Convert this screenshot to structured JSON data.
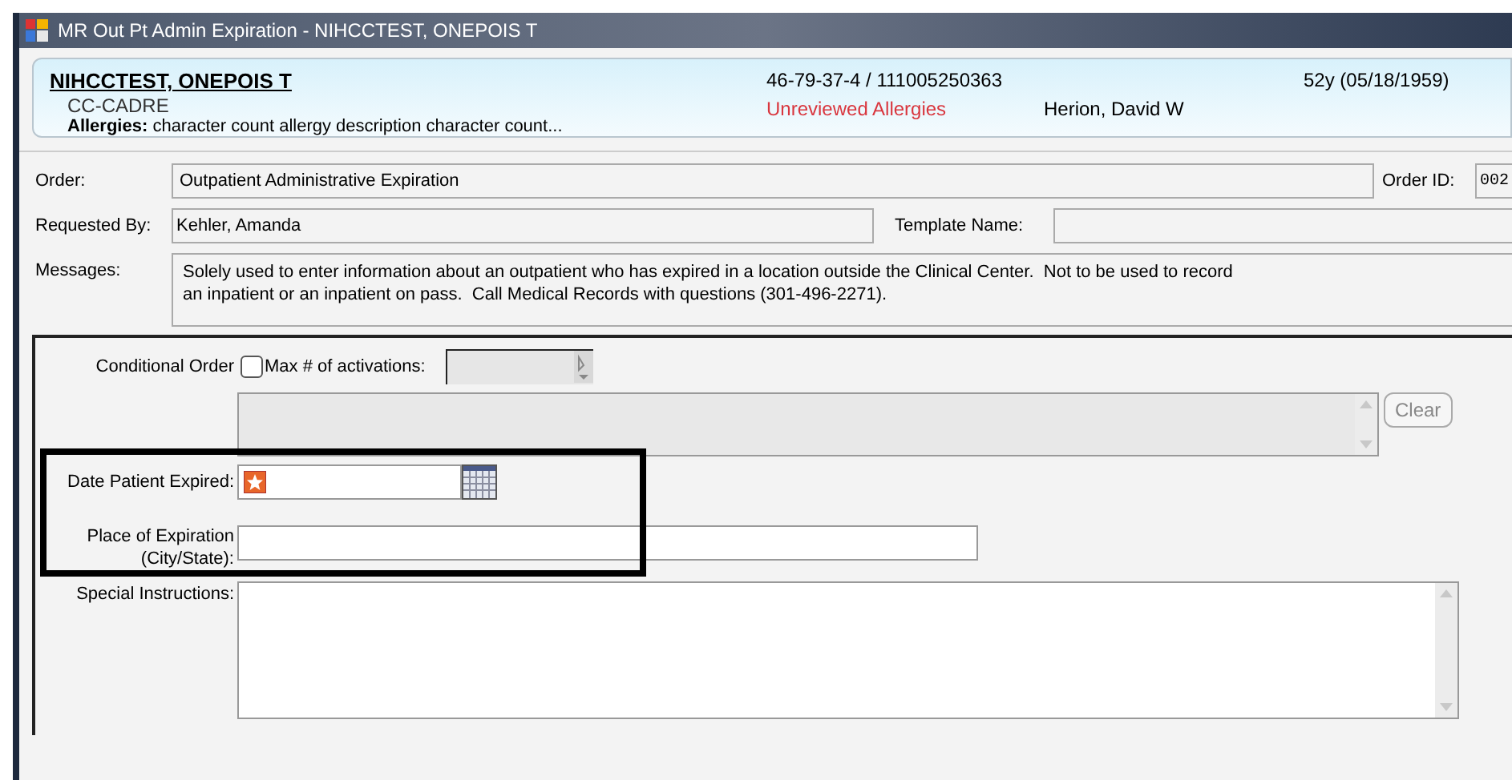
{
  "window": {
    "title": "MR Out Pt Admin Expiration - NIHCCTEST, ONEPOIS T"
  },
  "patient": {
    "name": "NIHCCTEST, ONEPOIS T",
    "location": "CC-CADRE",
    "allergies_label": "Allergies:",
    "allergies": "character count allergy description character count...",
    "ids": "46-79-37-4 / 111005250363",
    "alert": "Unreviewed Allergies",
    "physician": "Herion, David W",
    "age": "52y (05/18/1959)"
  },
  "order": {
    "order_label": "Order:",
    "order_value": "Outpatient Administrative Expiration",
    "order_id_label": "Order ID:",
    "order_id": "002",
    "requested_label": "Requested By:",
    "requested_value": "Kehler, Amanda",
    "template_label": "Template Name:",
    "messages_label": "Messages:",
    "message_lines": [
      "Solely used to enter information about an outpatient who has expired in a location outside the Clinical Center.  Not to be used to record",
      "an inpatient or an inpatient on pass.  Call Medical Records with questions (301-496-2271)."
    ]
  },
  "form": {
    "conditional_label": "Conditional Order",
    "conditional_checked": false,
    "max_label": "Max # of activations:",
    "clear_button": "Clear",
    "date_label": "Date Patient Expired:",
    "date_required": true,
    "place_label_lines": [
      "Place of Expiration",
      "(City/State):"
    ],
    "instructions_label": "Special Instructions:"
  }
}
